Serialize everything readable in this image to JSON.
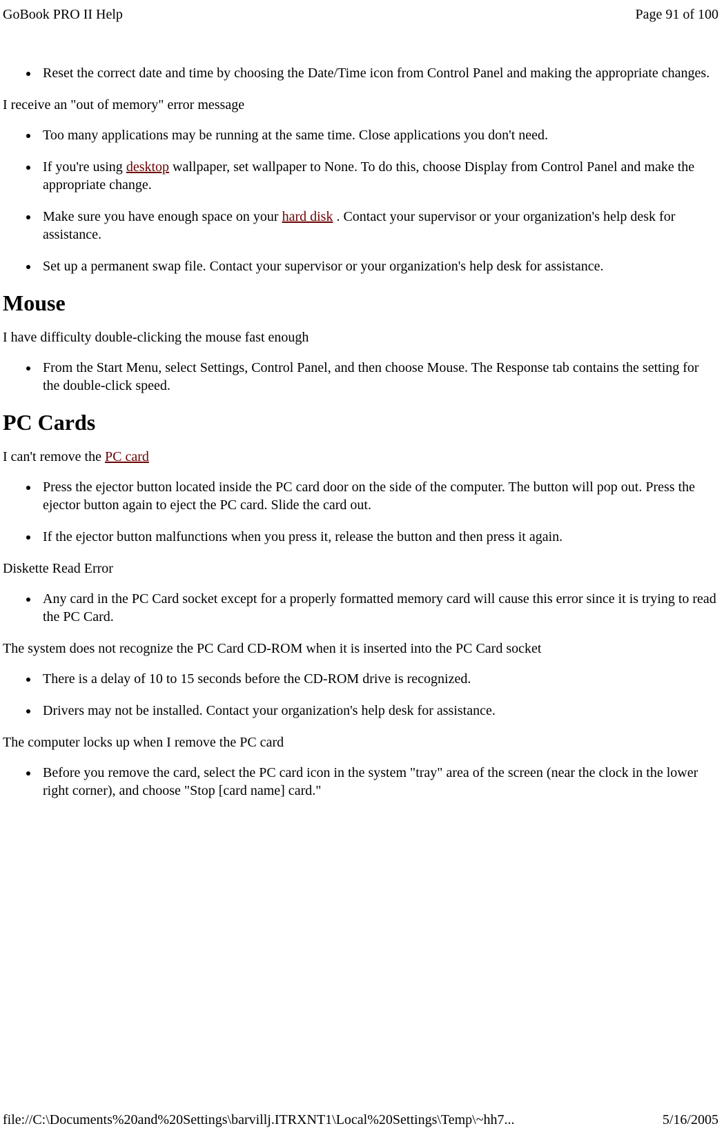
{
  "header": {
    "title": "GoBook PRO II Help",
    "page": "Page 91 of 100"
  },
  "list1": {
    "item1": "Reset the correct date and time by choosing the Date/Time icon from Control Panel and making the appropriate changes."
  },
  "issue1": "I receive an \"out of memory\" error message",
  "list2": {
    "item1": "Too many applications may be running at the same time. Close applications you don't need.",
    "item2a": "If you're using ",
    "item2_link": "desktop",
    "item2b": " wallpaper, set wallpaper to None. To do this, choose Display from Control Panel and make the appropriate change.",
    "item3a": "Make sure you have enough space on your ",
    "item3_link": "hard disk",
    "item3b": " . Contact your supervisor or your organization's help desk for assistance.",
    "item4": "Set up a permanent swap file. Contact your supervisor or your organization's help desk for assistance."
  },
  "heading1": "Mouse",
  "issue2": "I have difficulty double-clicking the mouse fast enough",
  "list3": {
    "item1": "From the Start Menu, select Settings, Control Panel, and then choose Mouse.  The Response tab contains the setting for the double-click speed."
  },
  "heading2": "PC Cards",
  "issue3a": "I can't remove the ",
  "issue3_link": "PC card",
  "list4": {
    "item1": "Press the ejector button located inside the PC card door on the side of the computer. The button will pop out. Press the ejector button again to eject the PC card.  Slide the card out.",
    "item2": "If the ejector button malfunctions when you press it, release the button and then press it again."
  },
  "issue4": "Diskette Read Error",
  "list5": {
    "item1": "Any card in the PC Card socket except for a properly formatted memory card will cause this error since it is trying to read the PC Card."
  },
  "issue5": "The system does not recognize the PC Card CD-ROM when it is inserted into the PC Card socket",
  "list6": {
    "item1": "There is a delay of 10 to 15 seconds before the CD-ROM drive is recognized.",
    "item2": "Drivers may not be installed. Contact your organization's help desk for assistance."
  },
  "issue6": "The computer locks up when I remove the PC card",
  "list7": {
    "item1": "Before you remove the card, select the PC card icon in the system \"tray\" area of the screen (near the clock in the lower right corner), and choose \"Stop [card name] card.\""
  },
  "footer": {
    "path": "file://C:\\Documents%20and%20Settings\\barvillj.ITRXNT1\\Local%20Settings\\Temp\\~hh7...",
    "date": "5/16/2005"
  }
}
